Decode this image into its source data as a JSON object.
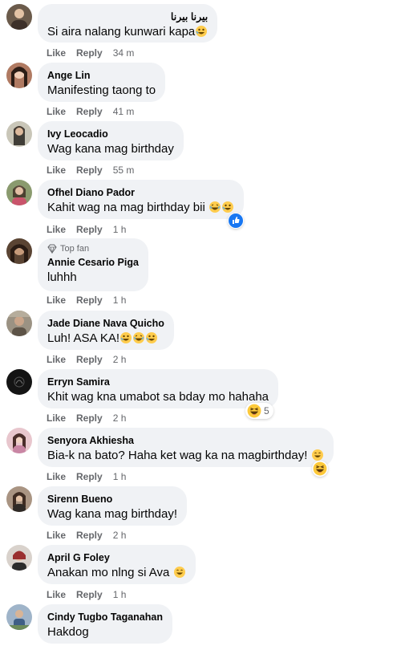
{
  "labels": {
    "like": "Like",
    "reply": "Reply"
  },
  "comments": [
    {
      "name": "بيرنا بيرنا",
      "text": "Si aira nalang kunwari kapa",
      "emoji": [
        "rofl"
      ],
      "time": "34 m",
      "avatar_color": "#6b5b4b"
    },
    {
      "name": "Ange Lin",
      "text": "Manifesting taong to",
      "emoji": [],
      "time": "41 m",
      "avatar_color": "#b07a62"
    },
    {
      "name": "Ivy Leocadio",
      "text": "Wag kana mag birthday",
      "emoji": [],
      "time": "55 m",
      "avatar_color": "#8c8a7d"
    },
    {
      "name": "Ofhel Diano Pador",
      "text": "Kahit wag na mag birthday bii",
      "emoji": [
        "laugh",
        "rofl"
      ],
      "time": "1 h",
      "avatar_color": "#7a6652",
      "reaction": "like"
    },
    {
      "name": "Annie Cesario Piga",
      "text": "luhhh",
      "emoji": [],
      "time": "1 h",
      "avatar_color": "#5a4433",
      "badge": "Top fan"
    },
    {
      "name": "Jade Diane Nava Quicho",
      "text": "Luh! ASA KA!",
      "emoji": [
        "rofl",
        "laugh",
        "rofl"
      ],
      "time": "2 h",
      "avatar_color": "#7d7262"
    },
    {
      "name": "Erryn Samira",
      "text": "Khit wag kna umabot sa bday mo hahaha",
      "emoji": [],
      "time": "2 h",
      "avatar_color": "#141414",
      "reaction": "haha",
      "reaction_count": "5"
    },
    {
      "name": "Senyora Akhiesha",
      "text": "Bia-k na bato? Haha ket wag ka na magbirthday!",
      "emoji": [
        "smile"
      ],
      "time": "1 h",
      "avatar_color": "#c79aa0",
      "reaction": "haha"
    },
    {
      "name": "Sirenn Bueno",
      "text": "Wag kana mag birthday!",
      "emoji": [],
      "time": "2 h",
      "avatar_color": "#6f5a4a"
    },
    {
      "name": "April G Foley",
      "text": "Anakan mo nlng si Ava",
      "emoji": [
        "smile"
      ],
      "time": "1 h",
      "avatar_color": "#9a3b3b"
    },
    {
      "name": "Cindy Tugbo Taganahan",
      "text": "Hakdog",
      "emoji": [],
      "time": "",
      "avatar_color": "#4f6f8f"
    }
  ]
}
